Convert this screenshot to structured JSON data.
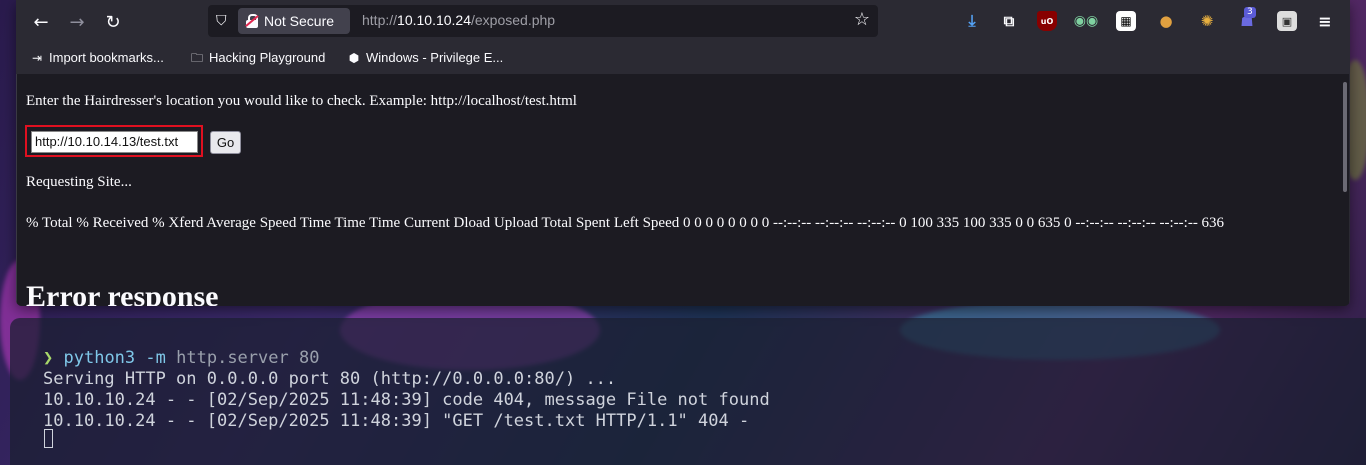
{
  "browser": {
    "nav": {
      "back_icon": "arrow-left-icon",
      "forward_icon": "arrow-right-icon",
      "reload_icon": "reload-icon"
    },
    "urlbar": {
      "security_label": "Not Secure",
      "url_prefix": "http://",
      "url_host": "10.10.10.24",
      "url_path": "/exposed.php"
    },
    "extensions": {
      "badge_count": "3",
      "ublock_label": "uO"
    },
    "bookmarks": [
      {
        "label": "Import bookmarks...",
        "icon": "import-icon"
      },
      {
        "label": "Hacking Playground",
        "icon": "folder-icon"
      },
      {
        "label": "Windows - Privilege E...",
        "icon": "site-icon"
      }
    ],
    "page": {
      "prompt_text": "Enter the Hairdresser's location you would like to check. Example: http://localhost/test.html",
      "input_value": "http://10.10.14.13/test.txt",
      "go_label": "Go",
      "requesting_text": "Requesting Site...",
      "curl_output": "% Total % Received % Xferd Average Speed Time Time Time Current Dload Upload Total Spent Left Speed 0 0 0 0 0 0 0 0 --:--:-- --:--:-- --:--:-- 0 100 335 100 335 0 0 635 0 --:--:-- --:--:-- --:--:-- 636",
      "error_heading": "Error response"
    }
  },
  "terminal": {
    "prompt_symbol": "❯",
    "command": "python3",
    "command_flag": "-m",
    "command_args": "http.server 80",
    "lines": [
      "Serving HTTP on 0.0.0.0 port 80 (http://0.0.0.0:80/) ...",
      "10.10.10.24 - - [02/Sep/2025 11:48:39] code 404, message File not found",
      "10.10.10.24 - - [02/Sep/2025 11:48:39] \"GET /test.txt HTTP/1.1\" 404 -"
    ]
  }
}
